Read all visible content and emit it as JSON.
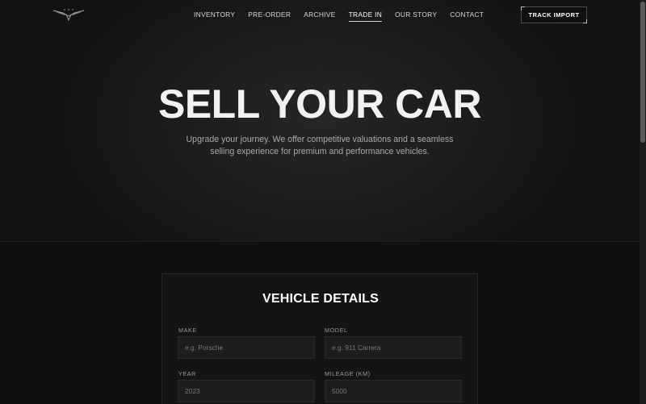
{
  "nav": {
    "links": [
      {
        "label": "INVENTORY"
      },
      {
        "label": "PRE-ORDER"
      },
      {
        "label": "ARCHIVE"
      },
      {
        "label": "TRADE IN",
        "active": true
      },
      {
        "label": "OUR STORY"
      },
      {
        "label": "CONTACT"
      }
    ],
    "track_button": "TRACK IMPORT",
    "logo_icon": "winged-logo-icon"
  },
  "hero": {
    "title": "SELL YOUR CAR",
    "subtitle": "Upgrade your journey. We offer competitive valuations and a seamless selling experience for premium and performance vehicles."
  },
  "form": {
    "title": "VEHICLE DETAILS",
    "make_label": "MAKE",
    "make_placeholder": "e.g. Porsche",
    "model_label": "MODEL",
    "model_placeholder": "e.g. 911 Carrera",
    "year_label": "YEAR",
    "year_placeholder": "2023",
    "mileage_label": "MILEAGE (KM)",
    "mileage_placeholder": "5000"
  },
  "colors": {
    "background": "#0f0f0f",
    "accent": "#ffffff"
  }
}
